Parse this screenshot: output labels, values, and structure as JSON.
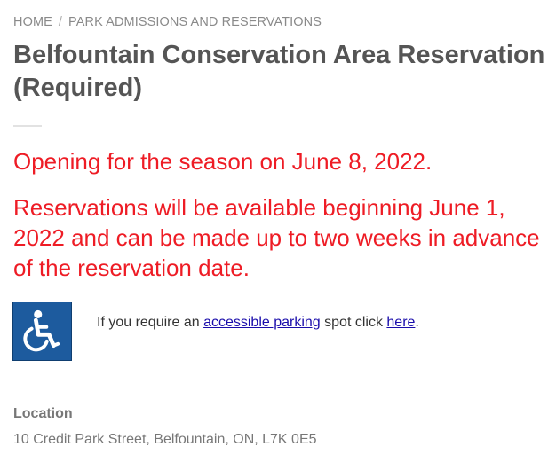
{
  "breadcrumb": {
    "home": "HOME",
    "separator": "/",
    "current": "PARK ADMISSIONS AND RESERVATIONS"
  },
  "page_title": "Belfountain Conservation Area Reservation (Required)",
  "notices": {
    "opening": "Opening for the season on June 8, 2022.",
    "reservations": "Reservations will be available beginning June 1, 2022 and can be made up to two weeks in advance of the reservation date."
  },
  "accessibility": {
    "icon": "wheelchair-icon",
    "text_before": "If you require an ",
    "link_parking": "accessible parking",
    "text_middle": " spot click ",
    "link_here": "here",
    "text_after": "."
  },
  "location": {
    "label": "Location",
    "address": "10 Credit Park Street, Belfountain, ON, L7K 0E5"
  },
  "colors": {
    "notice": "#ee1c25",
    "title": "#555555",
    "link": "#1a0dab",
    "icon_background": "#1d5b9e"
  }
}
